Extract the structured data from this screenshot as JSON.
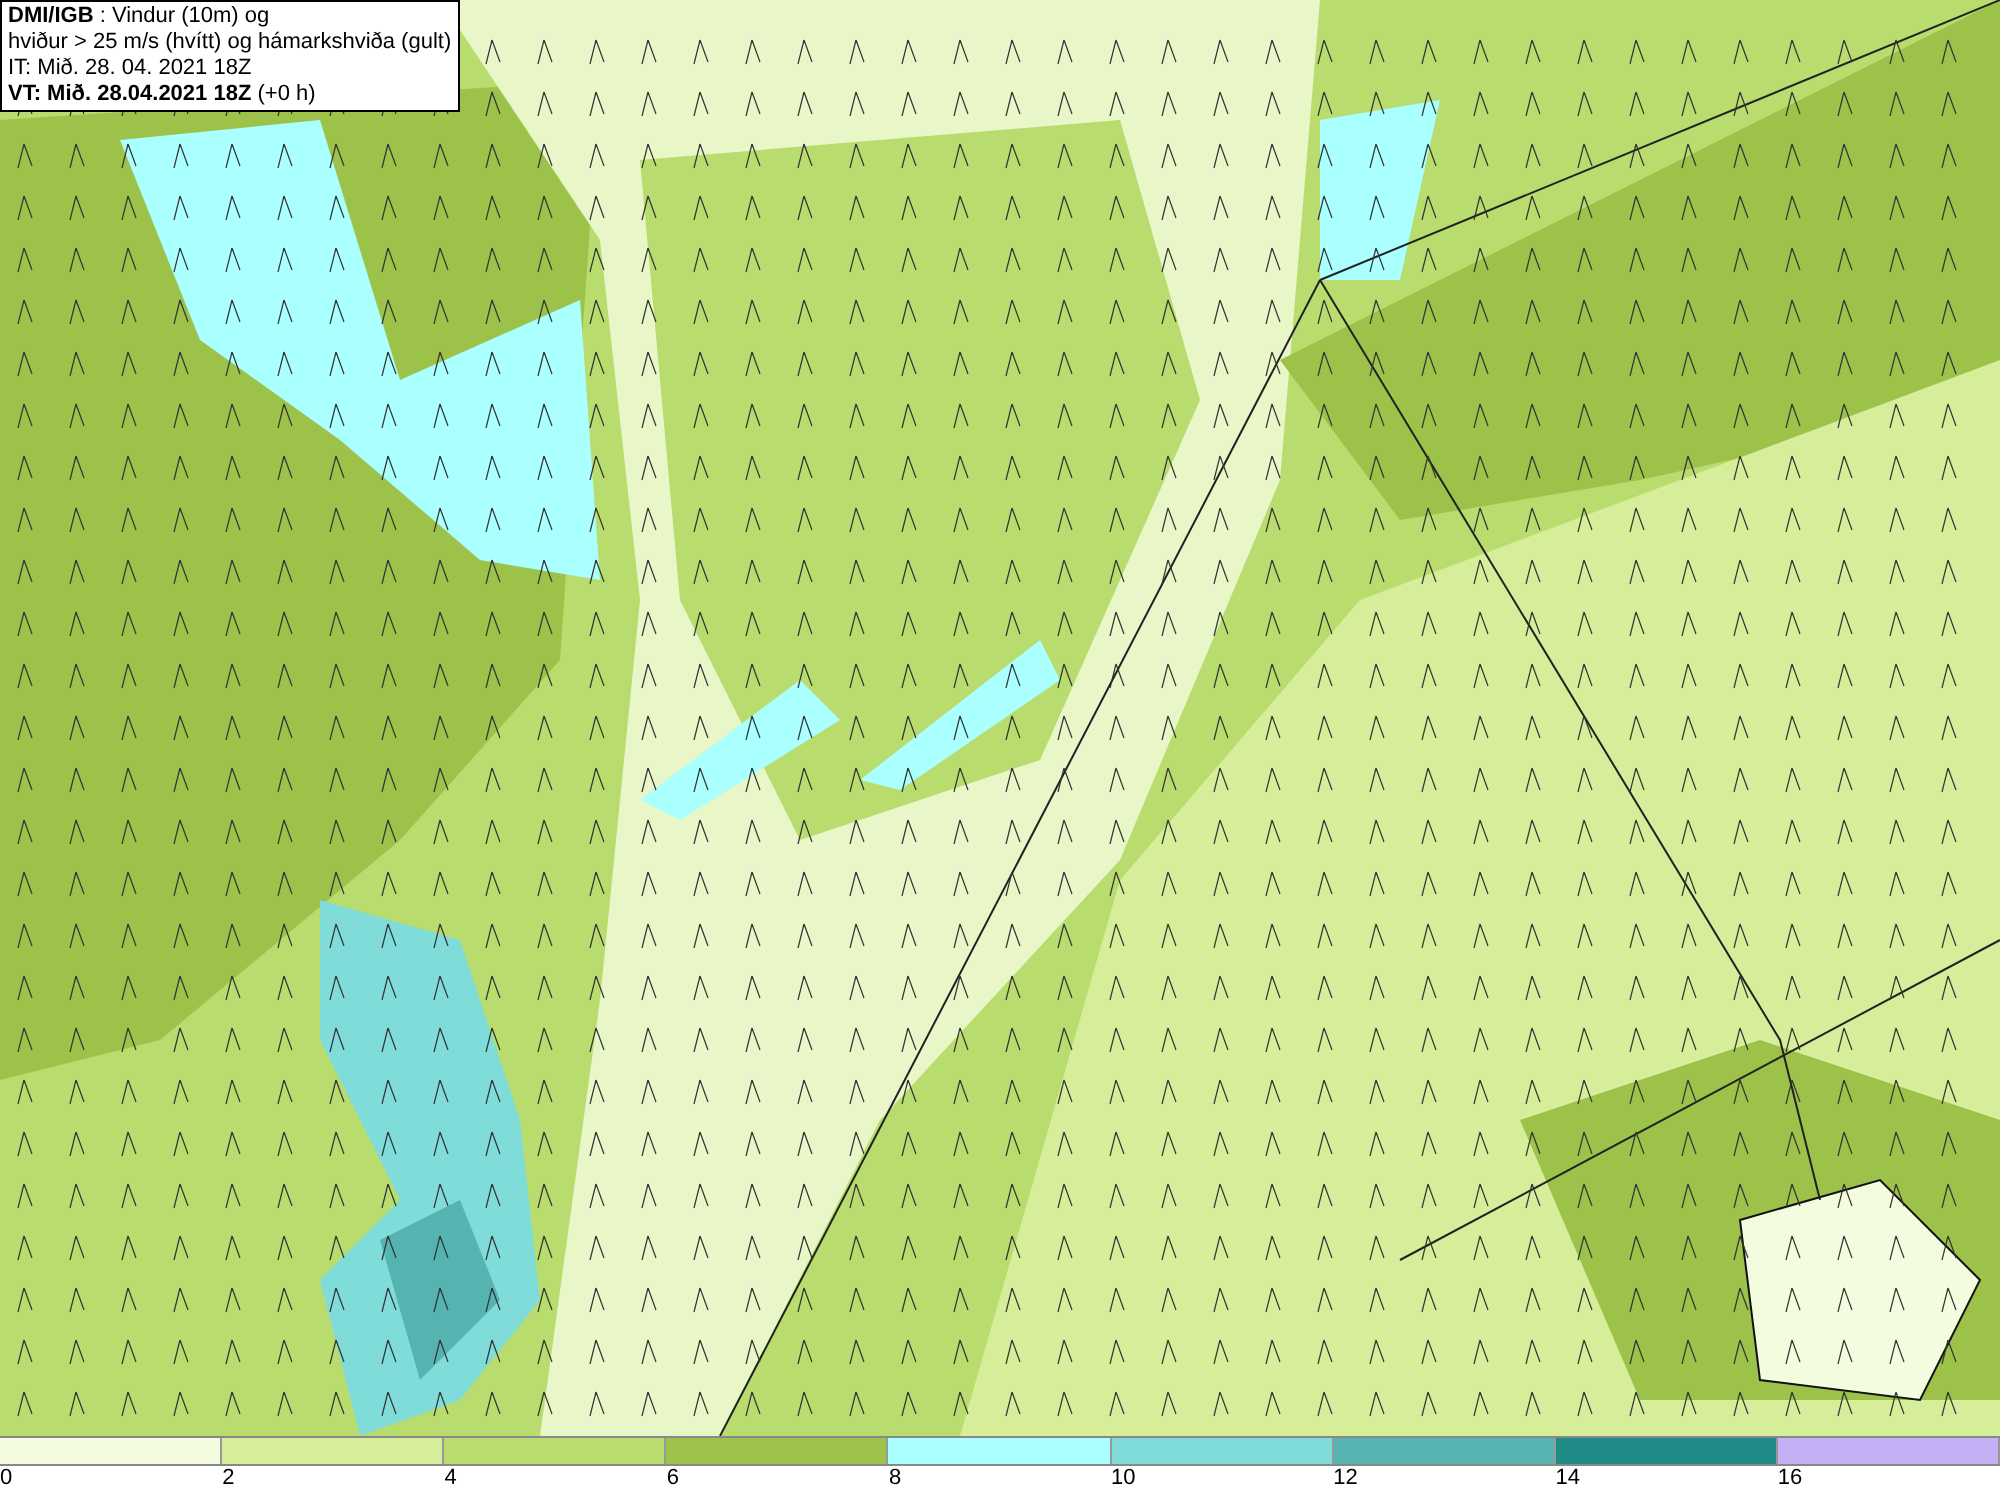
{
  "info_box": {
    "lines": [
      "**DMI/IGB** : Vindur (10m) og",
      "hviður > 25 m/s (hvítt) og hámarkshviða (gult)",
      "IT: Mið. 28. 04. 2021 18Z",
      "**VT: Mið. 28.04.2021 18Z** (+0 h)"
    ]
  },
  "legend": {
    "bins": [
      {
        "color": "#f4fce0"
      },
      {
        "color": "#d6ee9a"
      },
      {
        "color": "#b8dc6e"
      },
      {
        "color": "#9cc24a"
      },
      {
        "color": "#aaffff"
      },
      {
        "color": "#80dcd8"
      },
      {
        "color": "#56b4b0"
      },
      {
        "color": "#208c88"
      },
      {
        "color": "#c4b0f4"
      }
    ],
    "labels": [
      "0",
      "2",
      "4",
      "6",
      "8",
      "10",
      "12",
      "14",
      "16"
    ]
  }
}
